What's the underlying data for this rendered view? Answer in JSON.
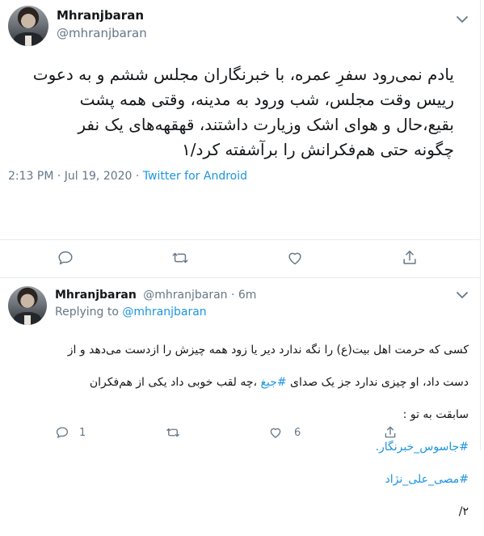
{
  "main_tweet": {
    "display_name": "Mhranjbaran",
    "handle": "@mhranjbaran",
    "text": "یادم نمی‌رود سفرِ عمره، با خبرنگاران مجلس ششم و به دعوت\nرییس وقت مجلس، شب ورود به مدینه، وقتی همه پشت\nبقیع،حال و هوای اشک وزیارت داشتند، قهقهه‌های یک نفر\nچگونه حتی هم‌فکرانش را برآشفته کرد/۱",
    "time": "2:13 PM · Jul 19, 2020 · ",
    "source": "Twitter for Android"
  },
  "reply_tweet": {
    "display_name": "Mhranjbaran",
    "handle_time": "@mhranjbaran · 6m",
    "replying_prefix": "Replying to ",
    "replying_handle": "@mhranjbaran",
    "line1": "کسی که حرمت اهل بیت(ع) را نگه ندارد دیر یا زود همه چیزش را ازدست می‌دهد و از",
    "line2_before": "دست داد، او چیزی ندارد جز یک صدای ",
    "hashtag1": "#جیغ",
    "line2_after": " ،چه لقب خوبی داد یکی از هم‌فکران",
    "line3": "سابقت به تو :",
    "hashtag2": "#جاسوس_خبرنگار.",
    "hashtag3": "#مصی_علی_نژاد",
    "line6": "۲/",
    "reply_count": "1",
    "like_count": "6"
  },
  "icons": [
    "chevron-down-icon",
    "reply-icon",
    "retweet-icon",
    "like-icon",
    "share-icon"
  ],
  "colors": {
    "link": "#1b95e0",
    "muted": "#657786",
    "divider": "#e6ecf0",
    "text": "#14171a"
  }
}
